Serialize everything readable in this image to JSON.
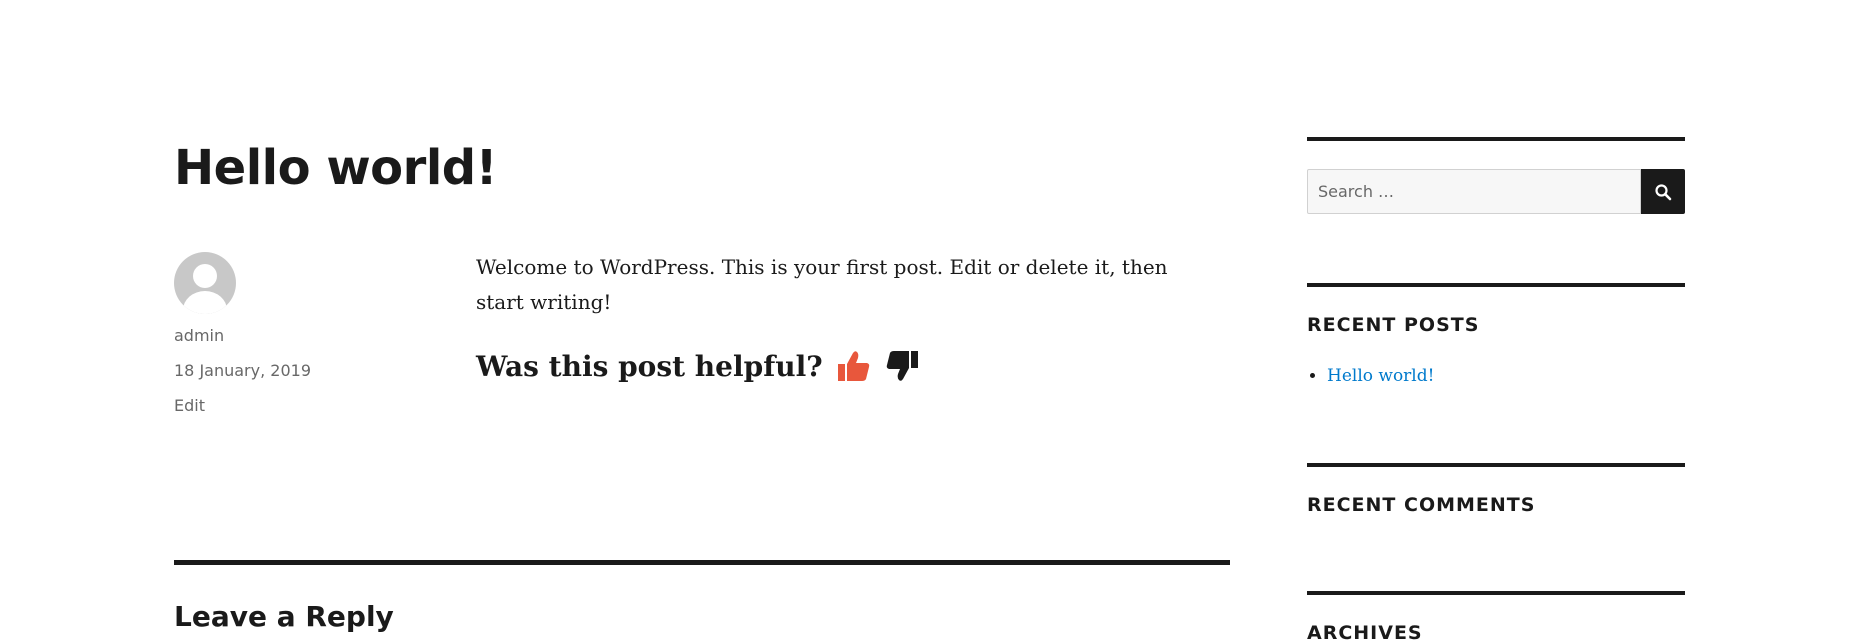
{
  "post": {
    "title": "Hello world!",
    "author": "admin",
    "date": "18 January, 2019",
    "edit_label": "Edit",
    "content": "Welcome to WordPress. This is your first post. Edit or delete it, then start writing!",
    "helpful_question": "Was this post helpful?"
  },
  "comments": {
    "reply_title": "Leave a Reply"
  },
  "sidebar": {
    "search": {
      "placeholder": "Search …"
    },
    "recent_posts": {
      "title": "RECENT POSTS",
      "items": [
        "Hello world!"
      ]
    },
    "recent_comments": {
      "title": "RECENT COMMENTS"
    },
    "archives": {
      "title": "ARCHIVES"
    }
  },
  "colors": {
    "text": "#1a1a1a",
    "meta": "#686868",
    "link": "#007acc",
    "thumbs_up": "#e8573c",
    "thumbs_down": "#1a1a1a"
  },
  "icons": {
    "thumbs_up": "thumbs-up-icon",
    "thumbs_down": "thumbs-down-icon",
    "search": "search-icon",
    "avatar": "avatar-icon"
  }
}
